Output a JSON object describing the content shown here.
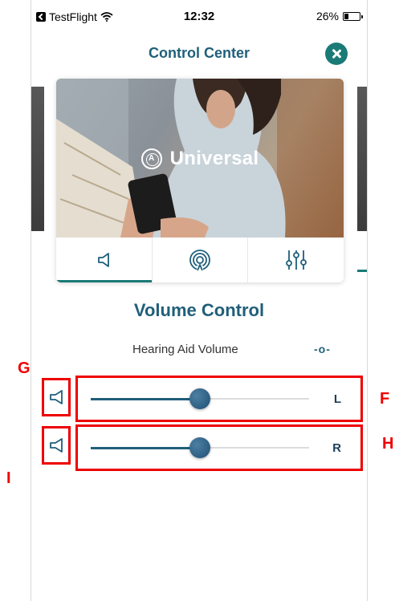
{
  "status_bar": {
    "carrier": "TestFlight",
    "time": "12:32",
    "battery": "26%",
    "battery_level": 0.26
  },
  "header": {
    "title": "Control Center",
    "close_icon": "close-icon"
  },
  "program": {
    "name": "Universal",
    "icon": "program-a-icon"
  },
  "tabs": [
    {
      "id": "volume",
      "icon": "speaker-icon",
      "active": true
    },
    {
      "id": "streaming",
      "icon": "broadcast-icon",
      "active": false
    },
    {
      "id": "equalizer",
      "icon": "sliders-icon",
      "active": false
    }
  ],
  "volume": {
    "title": "Volume Control",
    "label": "Hearing Aid Volume",
    "link_icon": "-o-",
    "left": {
      "side": "L",
      "level": 0.5
    },
    "right": {
      "side": "R",
      "level": 0.5
    }
  },
  "annotations": {
    "g": "G",
    "i": "I",
    "f": "F",
    "h": "H"
  },
  "colors": {
    "accent": "#1f5f7a",
    "teal": "#1a7a76",
    "annotation": "#ee0000"
  }
}
